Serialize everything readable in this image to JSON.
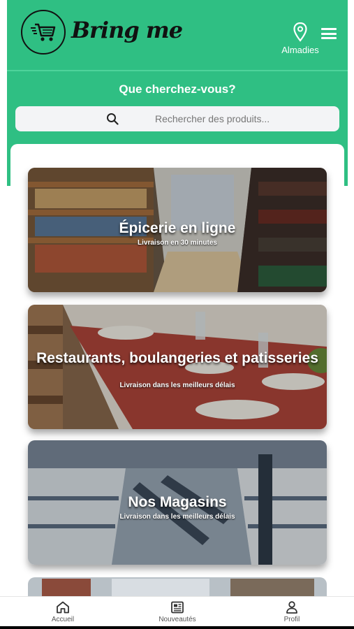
{
  "header": {
    "brand": "Bring me",
    "location": "Almadies"
  },
  "search": {
    "question": "Que cherchez-vous?",
    "placeholder": "Rechercher des produits..."
  },
  "categories": [
    {
      "title": "Épicerie en ligne",
      "subtitle": "Livraison en 30 minutes"
    },
    {
      "title": "Restaurants, boulangeries et patisseries",
      "subtitle": "Livraison dans les meilleurs délais"
    },
    {
      "title": "Nos Magasins",
      "subtitle": "Livraison dans les meilleurs délais"
    }
  ],
  "nav": [
    {
      "label": "Accueil",
      "icon": "home-icon"
    },
    {
      "label": "Nouveautés",
      "icon": "newspaper-icon"
    },
    {
      "label": "Profil",
      "icon": "user-icon"
    }
  ],
  "colors": {
    "brand_green": "#2fbf83"
  }
}
